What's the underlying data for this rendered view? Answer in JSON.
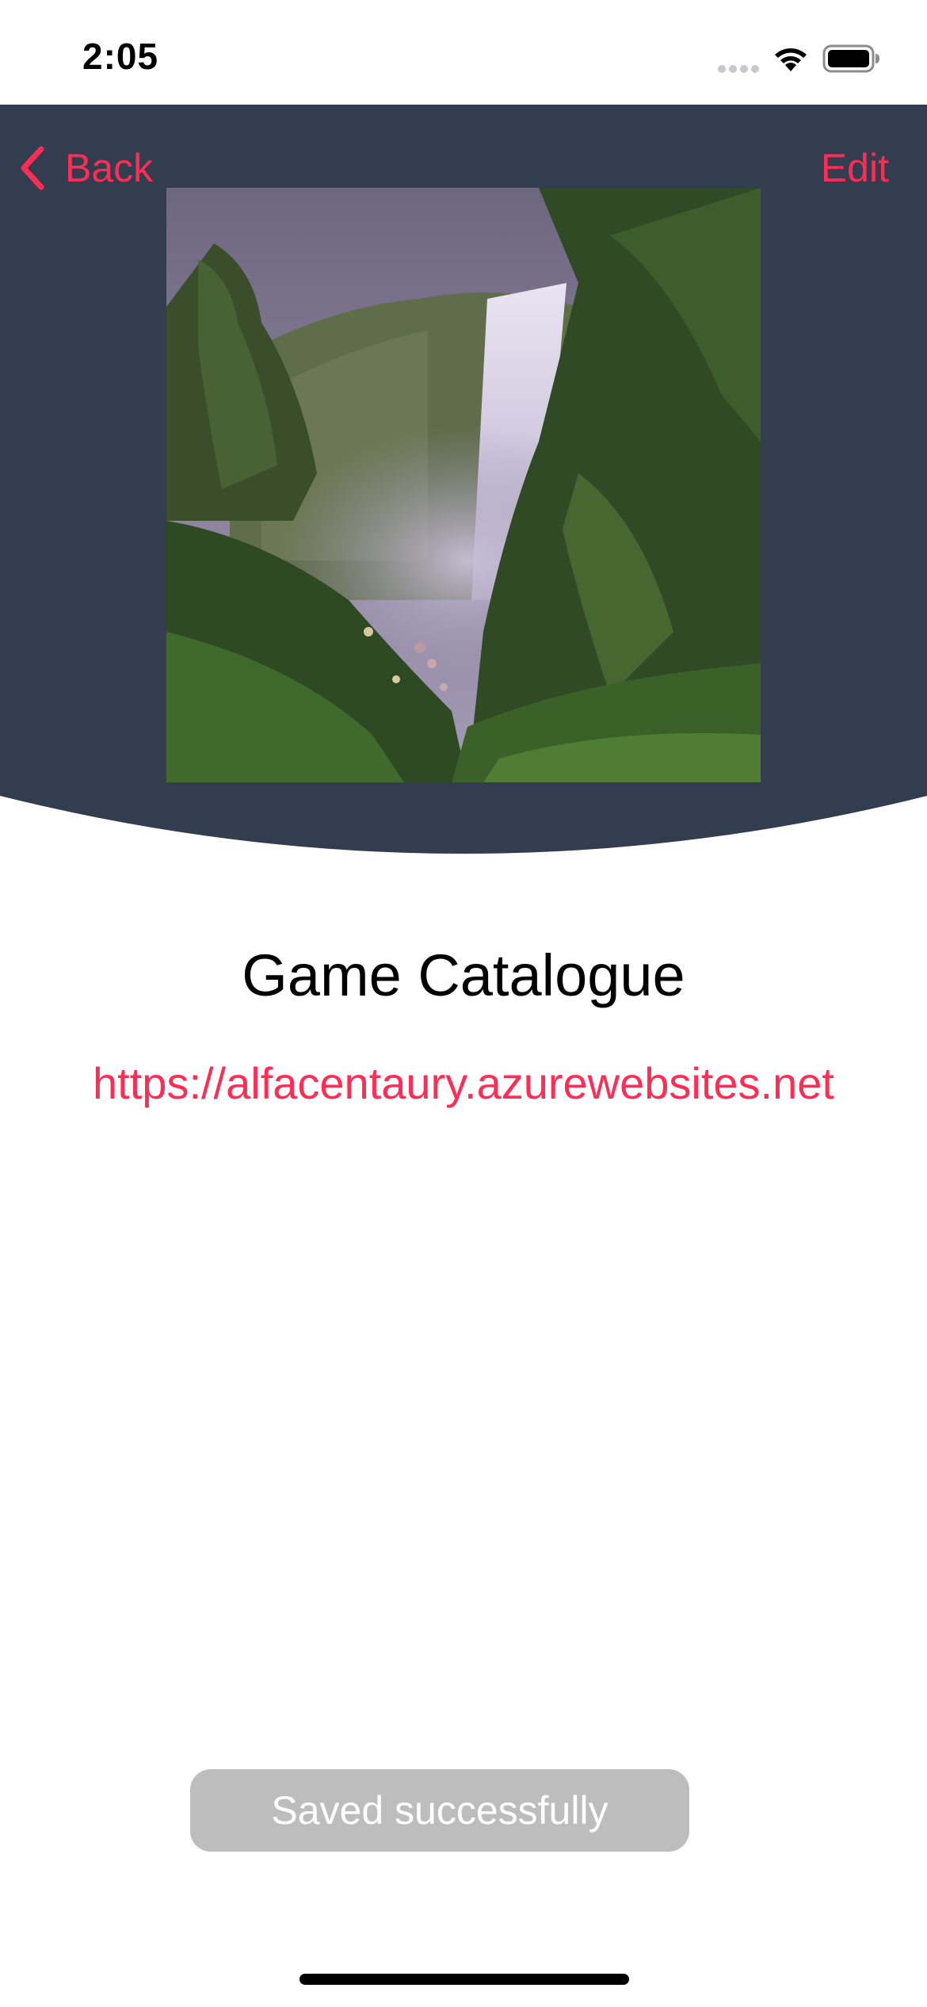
{
  "status_bar": {
    "time": "2:05",
    "icons": [
      "cellular-signal-icon",
      "wifi-icon",
      "battery-icon"
    ]
  },
  "nav": {
    "back_label": "Back",
    "edit_label": "Edit"
  },
  "content": {
    "title": "Game Catalogue",
    "url": "https://alfacentaury.azurewebsites.net"
  },
  "toast": {
    "message": "Saved successfully"
  },
  "colors": {
    "accent": "#ff2d55",
    "header_bg": "#323d4f",
    "toast_bg": "#bdbdbd"
  }
}
